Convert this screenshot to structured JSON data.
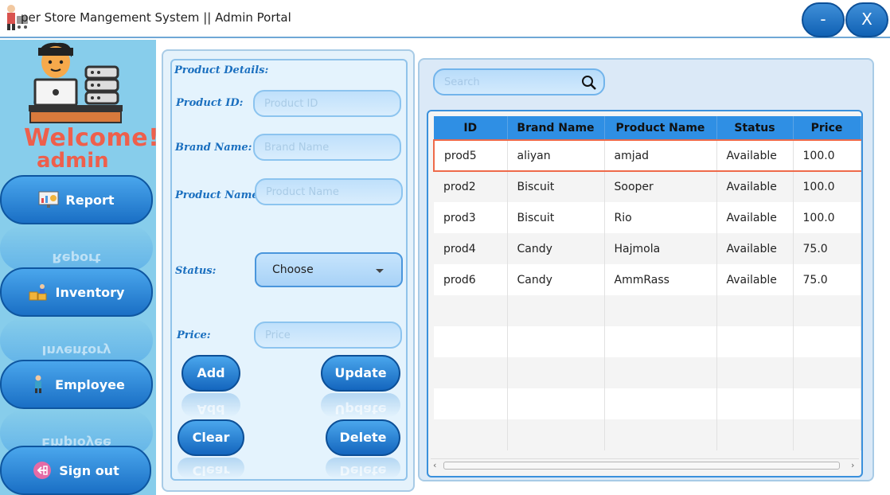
{
  "window": {
    "title": "per Store Mangement System || Admin Portal",
    "minimize_label": "-",
    "close_label": "X"
  },
  "sidebar": {
    "welcome": "Welcome!",
    "user": "admin",
    "items": [
      {
        "label": "Report",
        "icon": "report-chart-icon"
      },
      {
        "label": "Inventory",
        "icon": "inventory-icon"
      },
      {
        "label": "Employee",
        "icon": "employee-icon"
      },
      {
        "label": "Sign out",
        "icon": "signout-icon"
      }
    ]
  },
  "form": {
    "section_title": "Product Details:",
    "product_id": {
      "label": "Product ID:",
      "placeholder": "Product ID",
      "value": ""
    },
    "brand_name": {
      "label": "Brand Name:",
      "placeholder": "Brand Name",
      "value": ""
    },
    "product_name": {
      "label": "Product Name:",
      "placeholder": "Product Name",
      "value": ""
    },
    "status": {
      "label": "Status:",
      "selected": "Choose"
    },
    "price": {
      "label": "Price:",
      "placeholder": "Price",
      "value": ""
    },
    "buttons": {
      "add": "Add",
      "update": "Update",
      "clear": "Clear",
      "delete": "Delete"
    }
  },
  "search": {
    "placeholder": "Search",
    "value": ""
  },
  "table": {
    "columns": [
      "ID",
      "Brand Name",
      "Product Name",
      "Status",
      "Price"
    ],
    "rows": [
      [
        "prod5",
        "aliyan",
        "amjad",
        "Available",
        "100.0"
      ],
      [
        "prod2",
        "Biscuit",
        "Sooper",
        "Available",
        "100.0"
      ],
      [
        "prod3",
        "Biscuit",
        "Rio",
        "Available",
        "100.0"
      ],
      [
        "prod4",
        "Candy",
        "Hajmola",
        "Available",
        "75.0"
      ],
      [
        "prod6",
        "Candy",
        "AmmRass",
        "Available",
        "75.0"
      ]
    ],
    "selected_row": 0
  },
  "colors": {
    "accent": "#2f8fe4",
    "sidebar_bg": "#87cdeb",
    "welcome_text": "#ee5f4c",
    "selection_border": "#ee6a4a"
  }
}
